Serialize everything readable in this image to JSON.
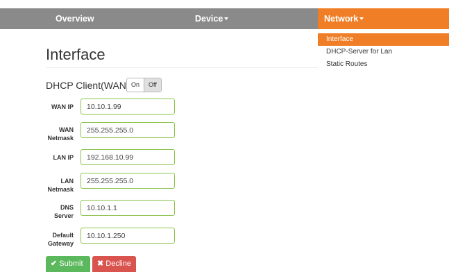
{
  "nav": {
    "items": [
      {
        "label": "Overview"
      },
      {
        "label": "Device"
      },
      {
        "label": "Network"
      }
    ]
  },
  "dropdown": {
    "items": [
      {
        "label": "Interface"
      },
      {
        "label": "DHCP-Server for Lan"
      },
      {
        "label": "Static Routes"
      }
    ]
  },
  "page": {
    "title": "Interface"
  },
  "dhcp": {
    "label": "DHCP Client(WAN):",
    "on_label": "On",
    "off_label": "Off"
  },
  "fields": [
    {
      "label_line1": "WAN IP",
      "label_line2": "",
      "value": "10.10.1.99"
    },
    {
      "label_line1": "WAN",
      "label_line2": "Netmask",
      "value": "255.255.255.0"
    },
    {
      "label_line1": "LAN IP",
      "label_line2": "",
      "value": "192.168.10.99"
    },
    {
      "label_line1": "LAN",
      "label_line2": "Netmask",
      "value": "255.255.255.0"
    },
    {
      "label_line1": "DNS",
      "label_line2": "Server",
      "value": "10.10.1.1"
    },
    {
      "label_line1": "Default",
      "label_line2": "Gateway",
      "value": "10.10.1.250"
    }
  ],
  "actions": {
    "submit_label": "Submit",
    "decline_label": "Decline"
  },
  "colors": {
    "nav_bg": "#8a8a8a",
    "accent": "#f07e26",
    "input_border": "#8bc34a",
    "submit": "#5cb85c",
    "decline": "#d9534f"
  }
}
